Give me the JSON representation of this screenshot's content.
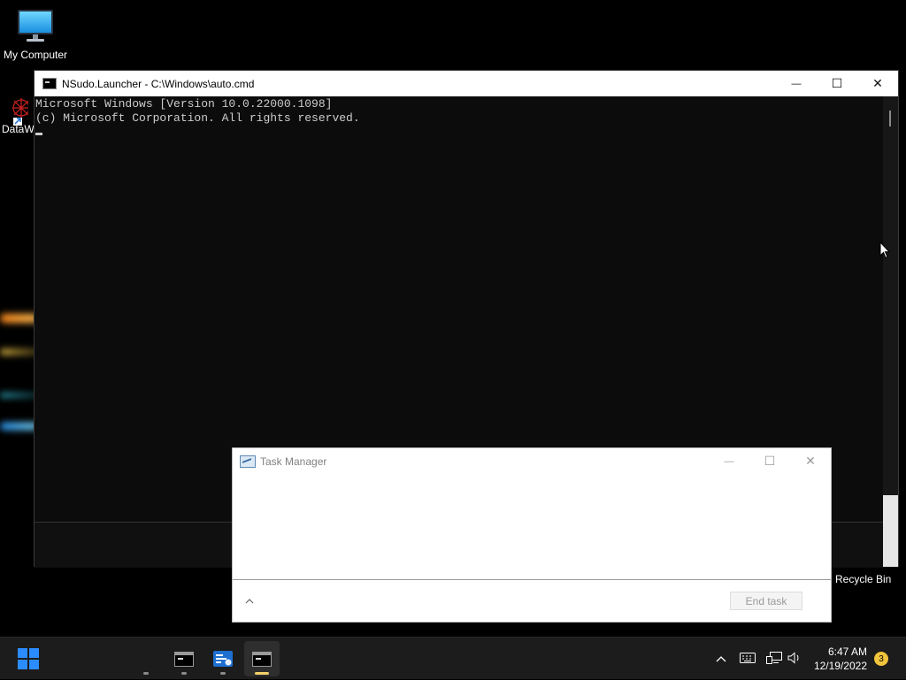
{
  "desktop": {
    "icons": [
      {
        "label": "My Computer",
        "icon": "monitor-icon"
      },
      {
        "label": "DataW",
        "icon": "shortcut-icon"
      },
      {
        "label": "Recycle Bin",
        "icon": "recycle-bin-icon"
      }
    ]
  },
  "cmd": {
    "title": "NSudo.Launcher - C:\\Windows\\auto.cmd",
    "lines": [
      "Microsoft Windows [Version 10.0.22000.1098]",
      "(c) Microsoft Corporation. All rights reserved."
    ]
  },
  "task_manager": {
    "title": "Task Manager",
    "end_task_label": "End task"
  },
  "window_controls": {
    "minimize": "—",
    "maximize": "☐",
    "close": "✕"
  },
  "taskbar": {
    "time": "6:47 AM",
    "date": "12/19/2022",
    "notification_count": "3",
    "tray_chevron": "^"
  },
  "colors": {
    "start_blue": "#2b8cff",
    "active_indicator": "#f3d36a"
  }
}
